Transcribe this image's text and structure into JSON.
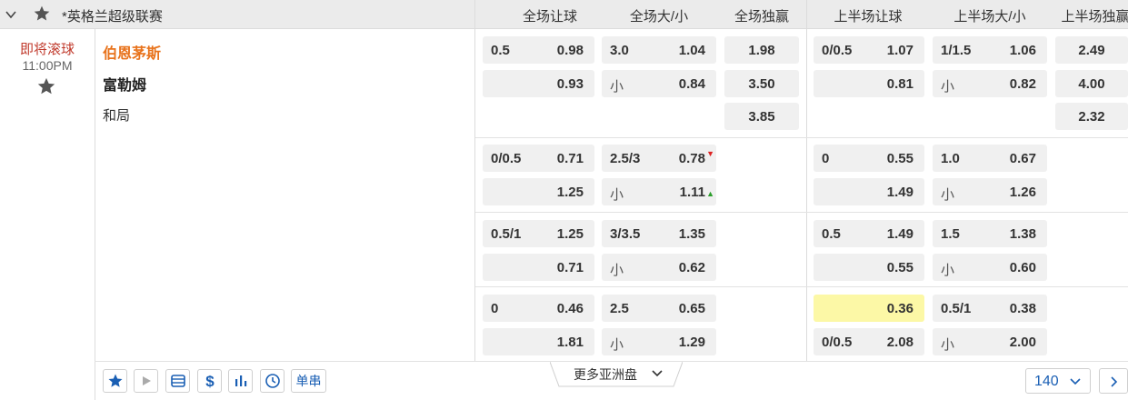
{
  "league": {
    "name": "*英格兰超级联赛"
  },
  "columns": [
    "全场让球",
    "全场大/小",
    "全场独赢",
    "上半场让球",
    "上半场大/小",
    "上半场独赢"
  ],
  "match": {
    "status": "即将滚球",
    "time": "11:00PM",
    "home": "伯恩茅斯",
    "away": "富勒姆",
    "draw": "和局"
  },
  "markets": [
    {
      "ft_hdp": {
        "line": "0.5",
        "home": "0.98",
        "away": "0.93"
      },
      "ft_ou": {
        "line": "3.0",
        "over": "1.04",
        "under_label": "小",
        "under": "0.84"
      },
      "ft_1x2": {
        "home": "1.98",
        "away": "3.50",
        "draw": "3.85"
      },
      "ht_hdp": {
        "line": "0/0.5",
        "home": "1.07",
        "away": "0.81"
      },
      "ht_ou": {
        "line": "1/1.5",
        "over": "1.06",
        "under_label": "小",
        "under": "0.82"
      },
      "ht_1x2": {
        "home": "2.49",
        "away": "4.00",
        "draw": "2.32"
      }
    },
    {
      "ft_hdp": {
        "line": "0/0.5",
        "home": "0.71",
        "away": "1.25"
      },
      "ft_ou": {
        "line": "2.5/3",
        "over": "0.78",
        "under_label": "小",
        "under": "1.11",
        "over_trend": "down",
        "under_trend": "up"
      },
      "ht_hdp": {
        "line": "0",
        "home": "0.55",
        "away": "1.49"
      },
      "ht_ou": {
        "line": "1.0",
        "over": "0.67",
        "under_label": "小",
        "under": "1.26"
      }
    },
    {
      "ft_hdp": {
        "line": "0.5/1",
        "home": "1.25",
        "away": "0.71"
      },
      "ft_ou": {
        "line": "3/3.5",
        "over": "1.35",
        "under_label": "小",
        "under": "0.62"
      },
      "ht_hdp": {
        "line": "0.5",
        "home": "1.49",
        "away": "0.55"
      },
      "ht_ou": {
        "line": "1.5",
        "over": "1.38",
        "under_label": "小",
        "under": "0.60"
      }
    },
    {
      "ft_hdp": {
        "line": "0",
        "home": "0.46",
        "away": "1.81"
      },
      "ft_ou": {
        "line": "2.5",
        "over": "0.65",
        "under_label": "小",
        "under": "1.29"
      },
      "ht_hdp": {
        "line": "",
        "home": "0.36",
        "away_line": "0/0.5",
        "away": "2.08",
        "highlight": true
      },
      "ht_ou": {
        "line": "0.5/1",
        "over": "0.38",
        "under_label": "小",
        "under": "2.00"
      }
    }
  ],
  "toolbar": {
    "parlay_label": "单串",
    "more_label": "更多亚洲盘",
    "page_size": "140"
  },
  "colors": {
    "header_bg": "#ebebeb",
    "cell_bg": "#f0f0f0",
    "highlight": "#fcf8a6",
    "home_team": "#e8731c",
    "live_status": "#c0392b",
    "link_blue": "#1a5fb4",
    "trend_down": "#d22222",
    "trend_up": "#2a9d2a"
  },
  "icons": {
    "collapse": "chevron-down-icon",
    "favorite": "star-icon",
    "play": "play-icon",
    "stats_board": "scoreboard-icon",
    "cashout": "dollar-icon",
    "chart": "bar-chart-icon",
    "history": "clock-icon",
    "next": "chevron-right-icon"
  }
}
